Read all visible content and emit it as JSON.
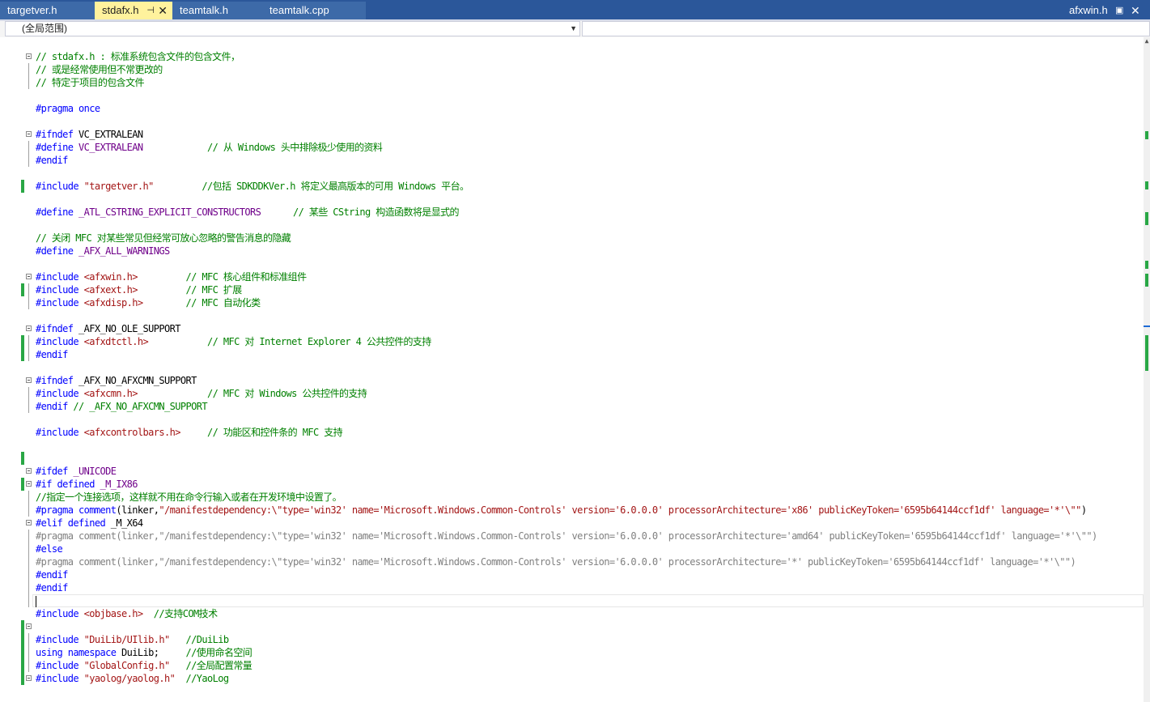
{
  "tabs": [
    {
      "label": "targetver.h",
      "active": false
    },
    {
      "label": "stdafx.h",
      "active": true
    },
    {
      "label": "teamtalk.h",
      "active": false
    },
    {
      "label": "teamtalk.cpp",
      "active": false
    }
  ],
  "right_tab": {
    "label": "afxwin.h"
  },
  "navbar": {
    "scope": "(全局范围)",
    "member": ""
  },
  "colors": {
    "tabstrip": "#2b579a",
    "active_tab": "#fff29d",
    "keyword": "#0000ff",
    "preprocessor": "#6f008a",
    "comment": "#008000",
    "string": "#a31515",
    "change_marker": "#29a745"
  },
  "code": [
    [
      {
        "c": "cm",
        "t": "// stdafx.h : 标准系统包含文件的包含文件，"
      }
    ],
    [
      {
        "c": "cm",
        "t": "// 或是经常使用但不常更改的"
      }
    ],
    [
      {
        "c": "cm",
        "t": "// 特定于项目的包含文件"
      }
    ],
    [],
    [
      {
        "c": "kw",
        "t": "#pragma"
      },
      {
        "c": "tx",
        "t": " "
      },
      {
        "c": "kw",
        "t": "once"
      }
    ],
    [],
    [
      {
        "c": "kw",
        "t": "#ifndef"
      },
      {
        "c": "tx",
        "t": " VC_EXTRALEAN"
      }
    ],
    [
      {
        "c": "kw",
        "t": "#define"
      },
      {
        "c": "tx",
        "t": " "
      },
      {
        "c": "pp",
        "t": "VC_EXTRALEAN"
      },
      {
        "c": "tx",
        "t": "            "
      },
      {
        "c": "cm",
        "t": "// 从 Windows 头中排除极少使用的资料"
      }
    ],
    [
      {
        "c": "kw",
        "t": "#endif"
      }
    ],
    [],
    [
      {
        "c": "kw",
        "t": "#include"
      },
      {
        "c": "tx",
        "t": " "
      },
      {
        "c": "st",
        "t": "\"targetver.h\""
      },
      {
        "c": "tx",
        "t": "         "
      },
      {
        "c": "cm",
        "t": "//包括 SDKDDKVer.h 将定义最高版本的可用 Windows 平台。"
      }
    ],
    [],
    [
      {
        "c": "kw",
        "t": "#define"
      },
      {
        "c": "tx",
        "t": " "
      },
      {
        "c": "pp",
        "t": "_ATL_CSTRING_EXPLICIT_CONSTRUCTORS"
      },
      {
        "c": "tx",
        "t": "      "
      },
      {
        "c": "cm",
        "t": "// 某些 CString 构造函数将是显式的"
      }
    ],
    [],
    [
      {
        "c": "cm",
        "t": "// 关闭 MFC 对某些常见但经常可放心忽略的警告消息的隐藏"
      }
    ],
    [
      {
        "c": "kw",
        "t": "#define"
      },
      {
        "c": "tx",
        "t": " "
      },
      {
        "c": "pp",
        "t": "_AFX_ALL_WARNINGS"
      }
    ],
    [],
    [
      {
        "c": "kw",
        "t": "#include"
      },
      {
        "c": "tx",
        "t": " "
      },
      {
        "c": "st",
        "t": "<afxwin.h>"
      },
      {
        "c": "tx",
        "t": "         "
      },
      {
        "c": "cm",
        "t": "// MFC 核心组件和标准组件"
      }
    ],
    [
      {
        "c": "kw",
        "t": "#include"
      },
      {
        "c": "tx",
        "t": " "
      },
      {
        "c": "st",
        "t": "<afxext.h>"
      },
      {
        "c": "tx",
        "t": "         "
      },
      {
        "c": "cm",
        "t": "// MFC 扩展"
      }
    ],
    [
      {
        "c": "kw",
        "t": "#include"
      },
      {
        "c": "tx",
        "t": " "
      },
      {
        "c": "st",
        "t": "<afxdisp.h>"
      },
      {
        "c": "tx",
        "t": "        "
      },
      {
        "c": "cm",
        "t": "// MFC 自动化类"
      }
    ],
    [],
    [
      {
        "c": "kw",
        "t": "#ifndef"
      },
      {
        "c": "tx",
        "t": " _AFX_NO_OLE_SUPPORT"
      }
    ],
    [
      {
        "c": "kw",
        "t": "#include"
      },
      {
        "c": "tx",
        "t": " "
      },
      {
        "c": "st",
        "t": "<afxdtctl.h>"
      },
      {
        "c": "tx",
        "t": "           "
      },
      {
        "c": "cm",
        "t": "// MFC 对 Internet Explorer 4 公共控件的支持"
      }
    ],
    [
      {
        "c": "kw",
        "t": "#endif"
      }
    ],
    [],
    [
      {
        "c": "kw",
        "t": "#ifndef"
      },
      {
        "c": "tx",
        "t": " _AFX_NO_AFXCMN_SUPPORT"
      }
    ],
    [
      {
        "c": "kw",
        "t": "#include"
      },
      {
        "c": "tx",
        "t": " "
      },
      {
        "c": "st",
        "t": "<afxcmn.h>"
      },
      {
        "c": "tx",
        "t": "             "
      },
      {
        "c": "cm",
        "t": "// MFC 对 Windows 公共控件的支持"
      }
    ],
    [
      {
        "c": "kw",
        "t": "#endif"
      },
      {
        "c": "tx",
        "t": " "
      },
      {
        "c": "cm",
        "t": "// _AFX_NO_AFXCMN_SUPPORT"
      }
    ],
    [],
    [
      {
        "c": "kw",
        "t": "#include"
      },
      {
        "c": "tx",
        "t": " "
      },
      {
        "c": "st",
        "t": "<afxcontrolbars.h>"
      },
      {
        "c": "tx",
        "t": "     "
      },
      {
        "c": "cm",
        "t": "// 功能区和控件条的 MFC 支持"
      }
    ],
    [],
    [],
    [
      {
        "c": "kw",
        "t": "#ifdef"
      },
      {
        "c": "tx",
        "t": " "
      },
      {
        "c": "pp",
        "t": "_UNICODE"
      }
    ],
    [
      {
        "c": "kw",
        "t": "#if"
      },
      {
        "c": "tx",
        "t": " "
      },
      {
        "c": "kw",
        "t": "defined"
      },
      {
        "c": "tx",
        "t": " "
      },
      {
        "c": "pp",
        "t": "_M_IX86"
      }
    ],
    [
      {
        "c": "cm",
        "t": "//指定一个连接选项，这样就不用在命令行输入或者在开发环境中设置了。"
      }
    ],
    [
      {
        "c": "kw",
        "t": "#pragma"
      },
      {
        "c": "tx",
        "t": " "
      },
      {
        "c": "kw",
        "t": "comment"
      },
      {
        "c": "tx",
        "t": "(linker,"
      },
      {
        "c": "st",
        "t": "\"/manifestdependency:\\\"type='win32' name='Microsoft.Windows.Common-Controls' version='6.0.0.0' processorArchitecture='x86' publicKeyToken='6595b64144ccf1df' language='*'\\\"\""
      },
      {
        "c": "tx",
        "t": ")"
      }
    ],
    [
      {
        "c": "kw",
        "t": "#elif"
      },
      {
        "c": "tx",
        "t": " "
      },
      {
        "c": "kw",
        "t": "defined"
      },
      {
        "c": "tx",
        "t": " _M_X64"
      }
    ],
    [
      {
        "c": "gray",
        "t": "#pragma comment(linker,\"/manifestdependency:\\\"type='win32' name='Microsoft.Windows.Common-Controls' version='6.0.0.0' processorArchitecture='amd64' publicKeyToken='6595b64144ccf1df' language='*'\\\"\")"
      }
    ],
    [
      {
        "c": "kw",
        "t": "#else"
      }
    ],
    [
      {
        "c": "gray",
        "t": "#pragma comment(linker,\"/manifestdependency:\\\"type='win32' name='Microsoft.Windows.Common-Controls' version='6.0.0.0' processorArchitecture='*' publicKeyToken='6595b64144ccf1df' language='*'\\\"\")"
      }
    ],
    [
      {
        "c": "kw",
        "t": "#endif"
      }
    ],
    [
      {
        "c": "kw",
        "t": "#endif"
      }
    ],
    [],
    [
      {
        "c": "kw",
        "t": "#include"
      },
      {
        "c": "tx",
        "t": " "
      },
      {
        "c": "st",
        "t": "<objbase.h>"
      },
      {
        "c": "tx",
        "t": "  "
      },
      {
        "c": "cm",
        "t": "//支持COM技术"
      }
    ],
    [],
    [
      {
        "c": "kw",
        "t": "#include"
      },
      {
        "c": "tx",
        "t": " "
      },
      {
        "c": "st",
        "t": "\"DuiLib/UIlib.h\""
      },
      {
        "c": "tx",
        "t": "   "
      },
      {
        "c": "cm",
        "t": "//DuiLib"
      }
    ],
    [
      {
        "c": "kw",
        "t": "using"
      },
      {
        "c": "tx",
        "t": " "
      },
      {
        "c": "kw",
        "t": "namespace"
      },
      {
        "c": "tx",
        "t": " DuiLib;     "
      },
      {
        "c": "cm",
        "t": "//使用命名空间"
      }
    ],
    [
      {
        "c": "kw",
        "t": "#include"
      },
      {
        "c": "tx",
        "t": " "
      },
      {
        "c": "st",
        "t": "\"GlobalConfig.h\""
      },
      {
        "c": "tx",
        "t": "   "
      },
      {
        "c": "cm",
        "t": "//全局配置常量"
      }
    ],
    [
      {
        "c": "kw",
        "t": "#include"
      },
      {
        "c": "tx",
        "t": " "
      },
      {
        "c": "st",
        "t": "\"yaolog/yaolog.h\""
      },
      {
        "c": "tx",
        "t": "  "
      },
      {
        "c": "cm",
        "t": "//YaoLog"
      }
    ]
  ]
}
